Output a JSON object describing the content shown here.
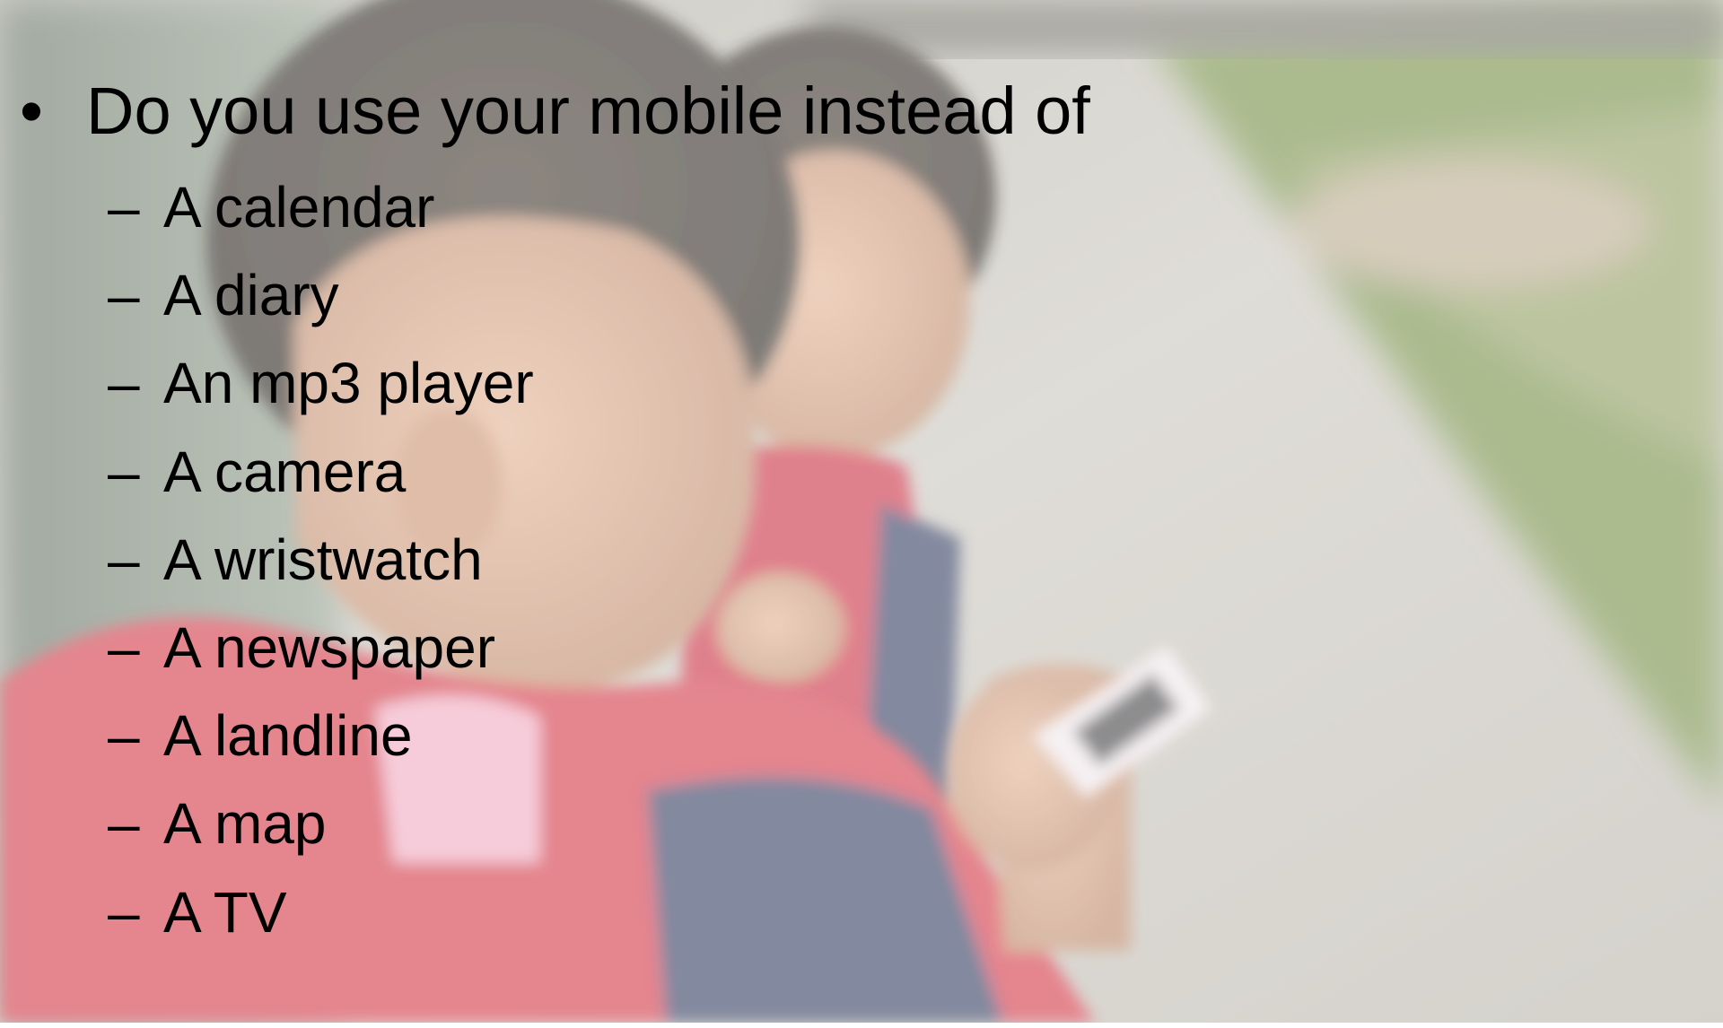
{
  "slide": {
    "question": "Do you use your mobile instead of",
    "bullet_symbol": "•",
    "dash_symbol": "–",
    "items": [
      "A calendar",
      "A diary",
      "An mp3 player",
      "A camera",
      "A wristwatch",
      "A newspaper",
      "A landline",
      "A map",
      "A TV"
    ]
  },
  "colors": {
    "text": "#000000",
    "jacket_red": "#d8323c",
    "jacket_navy": "#2f3a5c",
    "pavement": "#c9c4bc",
    "grass": "#6f8a3a",
    "wall": "#7c8a78"
  },
  "icons": {
    "background": "photo-of-boys-using-mobile-phone"
  }
}
